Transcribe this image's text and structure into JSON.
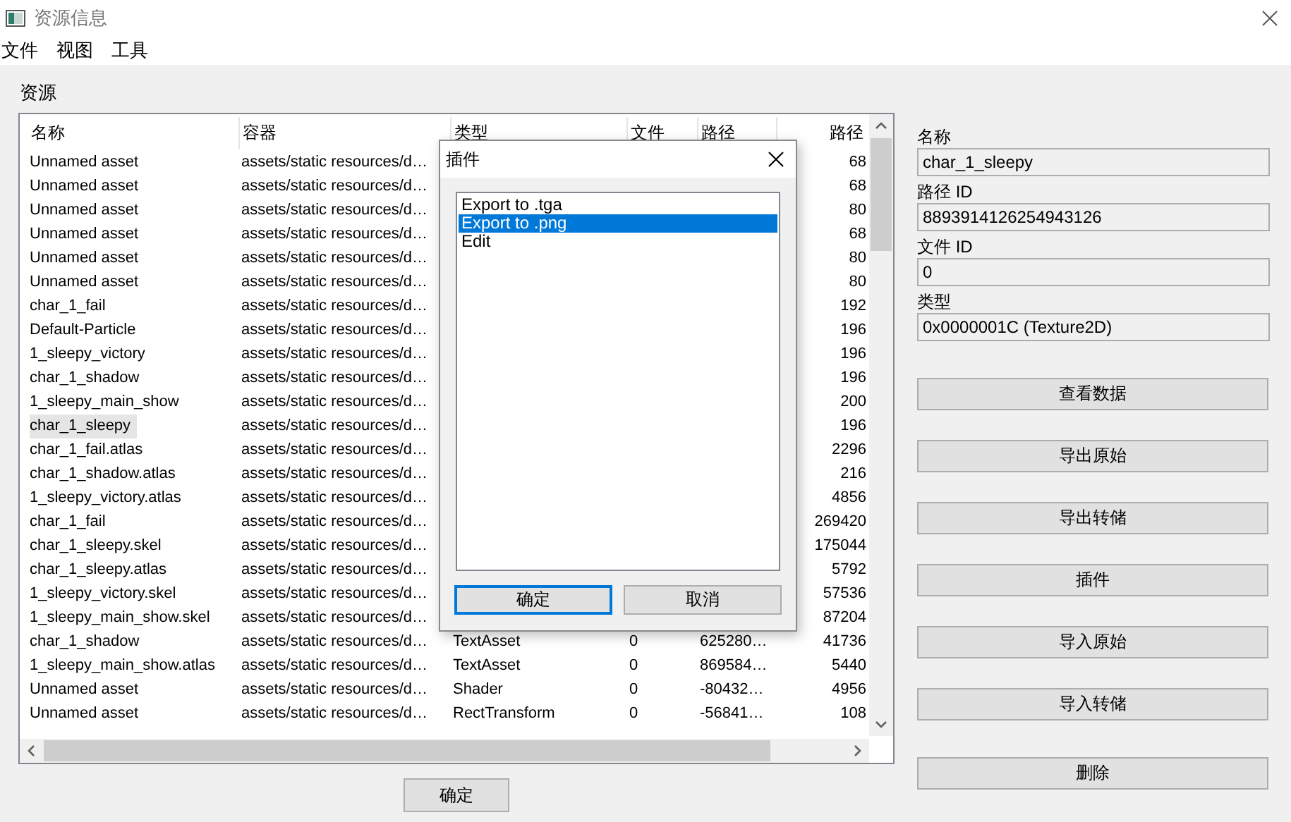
{
  "window": {
    "title": "资源信息"
  },
  "menu": [
    "文件",
    "视图",
    "工具"
  ],
  "assets": {
    "label": "资源",
    "columns": [
      "名称",
      "容器",
      "类型",
      "文件",
      "路径",
      "路径"
    ],
    "rows": [
      {
        "name": "Unnamed asset",
        "container": "assets/static resources/d…",
        "size": "68",
        "selected": false
      },
      {
        "name": "Unnamed asset",
        "container": "assets/static resources/d…",
        "size": "68",
        "selected": false
      },
      {
        "name": "Unnamed asset",
        "container": "assets/static resources/d…",
        "size": "80",
        "selected": false
      },
      {
        "name": "Unnamed asset",
        "container": "assets/static resources/d…",
        "size": "68",
        "selected": false
      },
      {
        "name": "Unnamed asset",
        "container": "assets/static resources/d…",
        "size": "80",
        "selected": false
      },
      {
        "name": "Unnamed asset",
        "container": "assets/static resources/d…",
        "size": "80",
        "selected": false
      },
      {
        "name": "char_1_fail",
        "container": "assets/static resources/d…",
        "size": "192",
        "selected": false
      },
      {
        "name": "Default-Particle",
        "container": "assets/static resources/d…",
        "size": "196",
        "selected": false
      },
      {
        "name": "1_sleepy_victory",
        "container": "assets/static resources/d…",
        "size": "196",
        "selected": false
      },
      {
        "name": "char_1_shadow",
        "container": "assets/static resources/d…",
        "size": "196",
        "selected": false
      },
      {
        "name": "1_sleepy_main_show",
        "container": "assets/static resources/d…",
        "size": "200",
        "selected": false
      },
      {
        "name": "char_1_sleepy",
        "container": "assets/static resources/d…",
        "size": "196",
        "selected": true
      },
      {
        "name": "char_1_fail.atlas",
        "container": "assets/static resources/d…",
        "size": "2296",
        "selected": false
      },
      {
        "name": "char_1_shadow.atlas",
        "container": "assets/static resources/d…",
        "size": "216",
        "selected": false
      },
      {
        "name": "1_sleepy_victory.atlas",
        "container": "assets/static resources/d…",
        "size": "4856",
        "selected": false
      },
      {
        "name": "char_1_fail",
        "container": "assets/static resources/d…",
        "size": "269420",
        "selected": false
      },
      {
        "name": "char_1_sleepy.skel",
        "container": "assets/static resources/d…",
        "size": "175044",
        "selected": false
      },
      {
        "name": "char_1_sleepy.atlas",
        "container": "assets/static resources/d…",
        "size": "5792",
        "selected": false
      },
      {
        "name": "1_sleepy_victory.skel",
        "container": "assets/static resources/d…",
        "size": "57536",
        "selected": false
      },
      {
        "name": "1_sleepy_main_show.skel",
        "container": "assets/static resources/d…",
        "size": "87204",
        "selected": false
      },
      {
        "name": "char_1_shadow",
        "container": "assets/static resources/d…",
        "type": "TextAsset",
        "file": "0",
        "path": "625280…",
        "size": "41736",
        "selected": false
      },
      {
        "name": "1_sleepy_main_show.atlas",
        "container": "assets/static resources/d…",
        "type": "TextAsset",
        "file": "0",
        "path": "869584…",
        "size": "5440",
        "selected": false
      },
      {
        "name": "Unnamed asset",
        "container": "assets/static resources/d…",
        "type": "Shader",
        "file": "0",
        "path": "-80432…",
        "size": "4956",
        "selected": false
      },
      {
        "name": "Unnamed asset",
        "container": "assets/static resources/d…",
        "type": "RectTransform",
        "file": "0",
        "path": "-56841…",
        "size": "108",
        "selected": false
      }
    ]
  },
  "details": {
    "fields": [
      {
        "label": "名称",
        "value": "char_1_sleepy"
      },
      {
        "label": "路径 ID",
        "value": "8893914126254943126"
      },
      {
        "label": "文件 ID",
        "value": "0"
      },
      {
        "label": "类型",
        "value": "0x0000001C (Texture2D)"
      }
    ],
    "buttons": [
      "查看数据",
      "导出原始",
      "导出转储",
      "插件",
      "导入原始",
      "导入转储",
      "删除"
    ]
  },
  "ok_button": "确定",
  "plugin_dialog": {
    "title": "插件",
    "items": [
      {
        "label": "Export to .tga",
        "selected": false
      },
      {
        "label": "Export to .png",
        "selected": true
      },
      {
        "label": "Edit",
        "selected": false
      }
    ],
    "buttons": [
      {
        "label": "确定",
        "focused": true
      },
      {
        "label": "取消",
        "focused": false
      }
    ]
  }
}
